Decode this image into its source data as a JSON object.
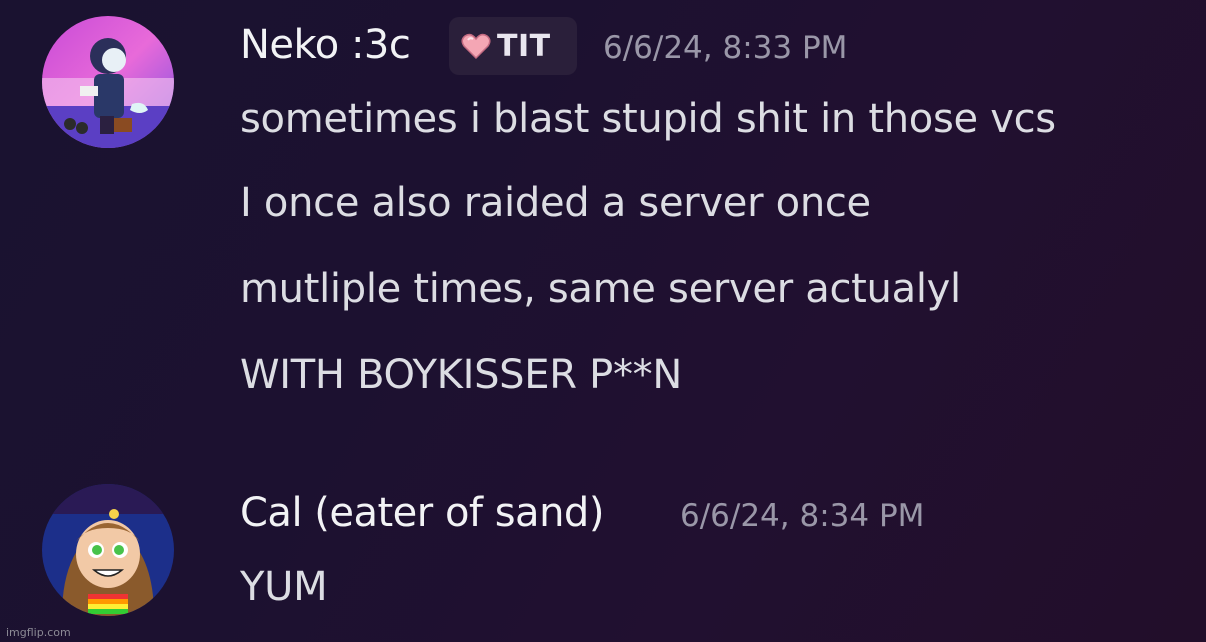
{
  "messages": [
    {
      "username": "Neko :3c",
      "tag": "TIT",
      "tag_icon": "heart-icon",
      "timestamp": "6/6/24, 8:33 PM",
      "lines": [
        "sometimes i blast stupid shit in those vcs",
        "I once also raided a server once",
        "mutliple times, same server actualyl",
        "WITH BOYKISSER P**N"
      ]
    },
    {
      "username": "Cal (eater of sand)",
      "timestamp": "6/6/24, 8:34 PM",
      "lines": [
        "YUM"
      ]
    }
  ],
  "watermark": "imgflip.com",
  "colors": {
    "username": "#f2f3f5",
    "timestamp": "#9a97a8",
    "message_text": "#dcdde3",
    "tag_background": "#2a1f3a",
    "heart": "#f4a6b4"
  }
}
